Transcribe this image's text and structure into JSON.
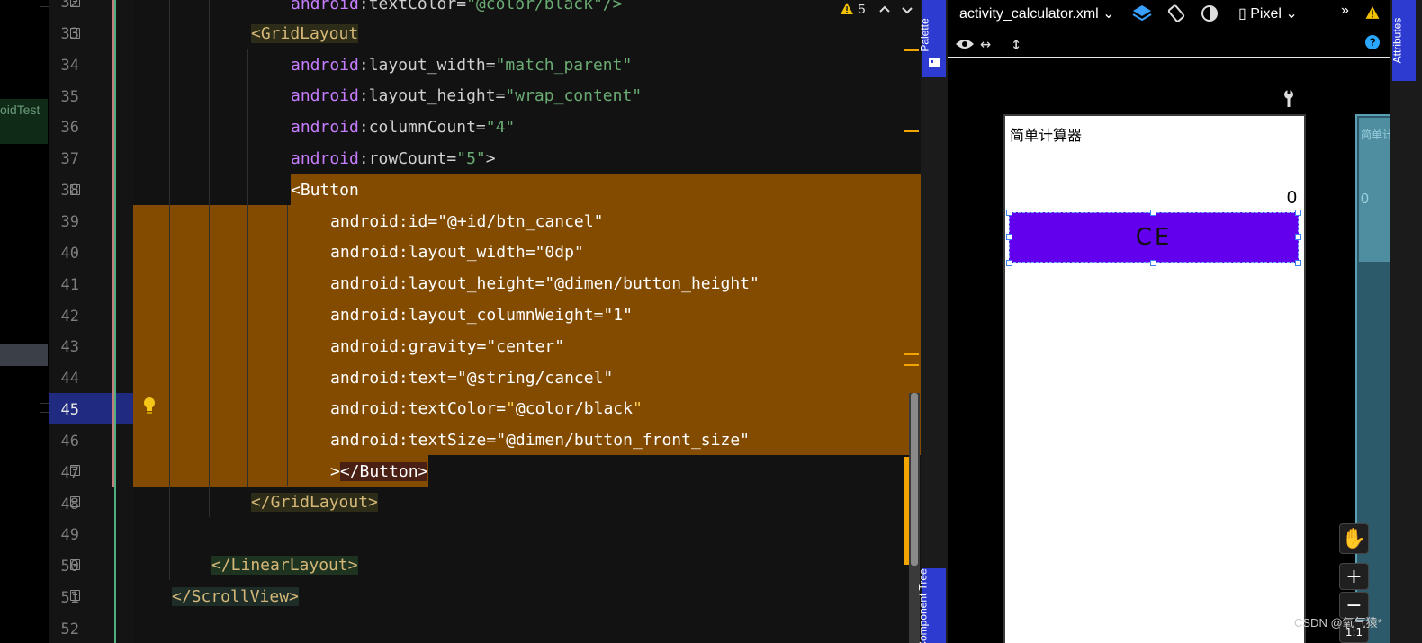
{
  "left_panel": {
    "tab_label": "oidTest"
  },
  "gutter": {
    "line_numbers": [
      "32",
      "33",
      "34",
      "35",
      "36",
      "37",
      "38",
      "39",
      "40",
      "41",
      "42",
      "43",
      "44",
      "45",
      "46",
      "47",
      "48",
      "49",
      "50",
      "51",
      "52"
    ],
    "current_line": "45"
  },
  "editor": {
    "warnings": {
      "count": "5"
    },
    "lines": {
      "l32": {
        "prefix": "android",
        "attr": ":textColor",
        "eq": "=",
        "value": "\"@color/black\"/>"
      },
      "l33": {
        "tag": "<GridLayout"
      },
      "l34": {
        "prefix": "android",
        "attr": ":layout_width",
        "eq": "=",
        "value": "\"match_parent\""
      },
      "l35": {
        "prefix": "android",
        "attr": ":layout_height",
        "eq": "=",
        "value": "\"wrap_content\""
      },
      "l36": {
        "prefix": "android",
        "attr": ":columnCount",
        "eq": "=",
        "value": "\"4\""
      },
      "l37": {
        "prefix": "android",
        "attr": ":rowCount",
        "eq": "=",
        "value": "\"5\"",
        "close": ">"
      },
      "l38": {
        "tag": "<Button"
      },
      "l39": {
        "text": "android:id=\"@+id/btn_cancel\""
      },
      "l40": {
        "text": "android:layout_width=\"0dp\""
      },
      "l41": {
        "text": "android:layout_height=\"@dimen/button_height\""
      },
      "l42": {
        "text": "android:layout_columnWeight=\"1\""
      },
      "l43": {
        "text": "android:gravity=\"center\""
      },
      "l44": {
        "text": "android:text=\"@string/cancel\""
      },
      "l45": {
        "text_a": "android:textColor=",
        "text_b": "\"",
        "text_c": "@color/black",
        "text_d": "\""
      },
      "l46": {
        "text": "android:textSize=\"@dimen/button_front_size\""
      },
      "l47": {
        "text_a": ">",
        "text_b": "</Button>"
      },
      "l48": {
        "tag": "</GridLayout>"
      },
      "l50": {
        "tag": "</LinearLayout>"
      },
      "l51": {
        "tag": "</ScrollView>"
      }
    }
  },
  "side_tabs": {
    "palette": "Palette",
    "component_tree": "Component Tree",
    "attributes": "Attributes"
  },
  "preview": {
    "file_name": "activity_calculator.xml",
    "device": "Pixel",
    "app_title": "简单计算器",
    "display_value": "0",
    "button_text": "CE",
    "blueprint_title": "简单计",
    "blueprint_value": "0",
    "zoom_in": "+",
    "zoom_out": "−",
    "zoom_ratio": "1:1"
  },
  "watermark": "CSDN @氧气猿*"
}
